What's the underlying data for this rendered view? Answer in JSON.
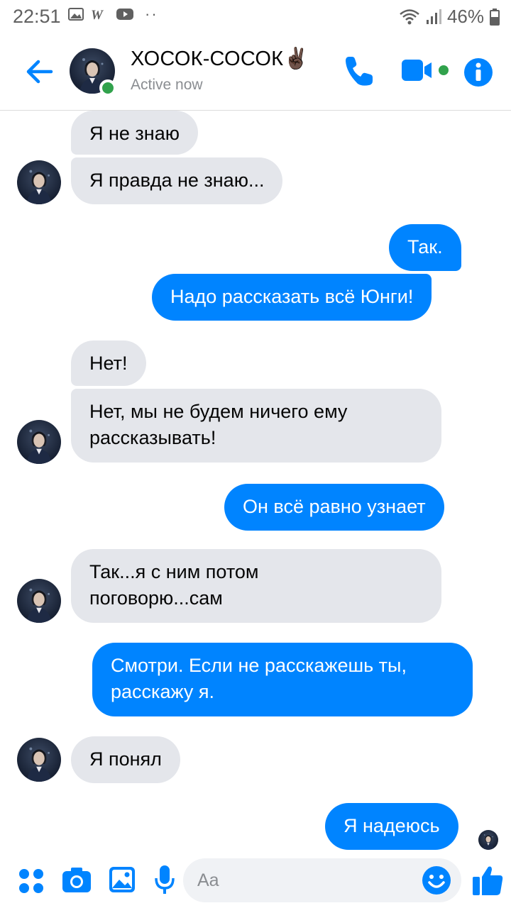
{
  "status_bar": {
    "time": "22:51",
    "left_icons": [
      "image-icon",
      "w-app-icon",
      "youtube-icon"
    ],
    "more": "··",
    "battery": "46%"
  },
  "header": {
    "contact_name": "ХОСОК-СОСОК✌🏿",
    "status": "Active now",
    "accent_color": "#0084ff",
    "online_color": "#31a24c"
  },
  "messages": [
    {
      "side": "in",
      "text": "Я не знаю"
    },
    {
      "side": "in",
      "text": "Я правда не знаю..."
    },
    {
      "side": "out",
      "text": "Так."
    },
    {
      "side": "out",
      "text": "Надо рассказать всё Юнги!"
    },
    {
      "side": "in",
      "text": "Нет!"
    },
    {
      "side": "in",
      "text": "Нет, мы не будем ничего ему\nрассказывать!"
    },
    {
      "side": "out",
      "text": "Он всё равно узнает"
    },
    {
      "side": "in",
      "text": "Так...я с ним потом\nпоговорю...сам"
    },
    {
      "side": "out",
      "text": "Смотри. Если не расскажешь ты,\nрасскажу я."
    },
    {
      "side": "in",
      "text": "Я понял"
    },
    {
      "side": "out",
      "text": "Я надеюсь"
    }
  ],
  "composer": {
    "placeholder": "Aa",
    "icons": [
      "apps-icon",
      "camera-icon",
      "gallery-icon",
      "microphone-icon",
      "emoji-icon",
      "thumbs-up-icon"
    ]
  }
}
